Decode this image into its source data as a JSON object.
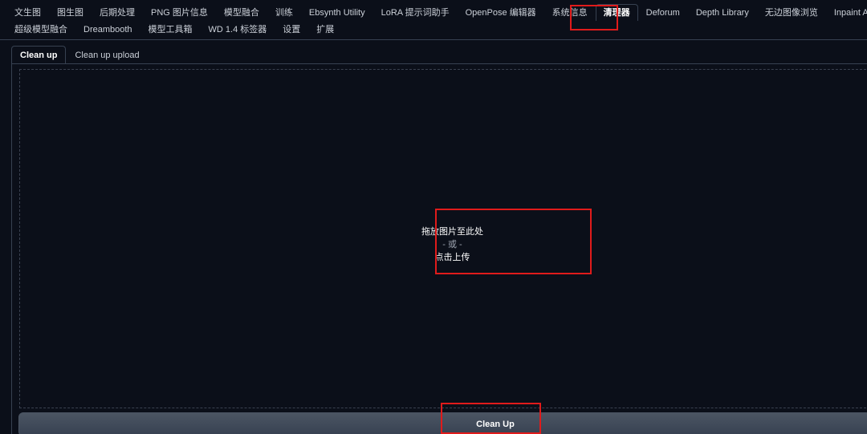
{
  "top_tabs_row1": [
    "文生图",
    "图生图",
    "后期处理",
    "PNG 图片信息",
    "模型融合",
    "训练",
    "Ebsynth Utility",
    "LoRA 提示词助手",
    "OpenPose 编辑器",
    "系统信息",
    "清理器",
    "Deforum",
    "Depth Library",
    "无边图像浏览",
    "Inpaint Anyth"
  ],
  "top_tabs_row2": [
    "超级模型融合",
    "Dreambooth",
    "模型工具箱",
    "WD 1.4 标签器",
    "设置",
    "扩展"
  ],
  "active_top_tab": "清理器",
  "sub_tabs": [
    "Clean up",
    "Clean up upload"
  ],
  "active_sub_tab": "Clean up",
  "dropzone": {
    "main": "拖放图片至此处",
    "or": "- 或 -",
    "click": "点击上传"
  },
  "cleanup_button": "Clean Up",
  "colors": {
    "background": "#0b0f19",
    "border": "#374151",
    "annotation": "#e01b1b"
  }
}
